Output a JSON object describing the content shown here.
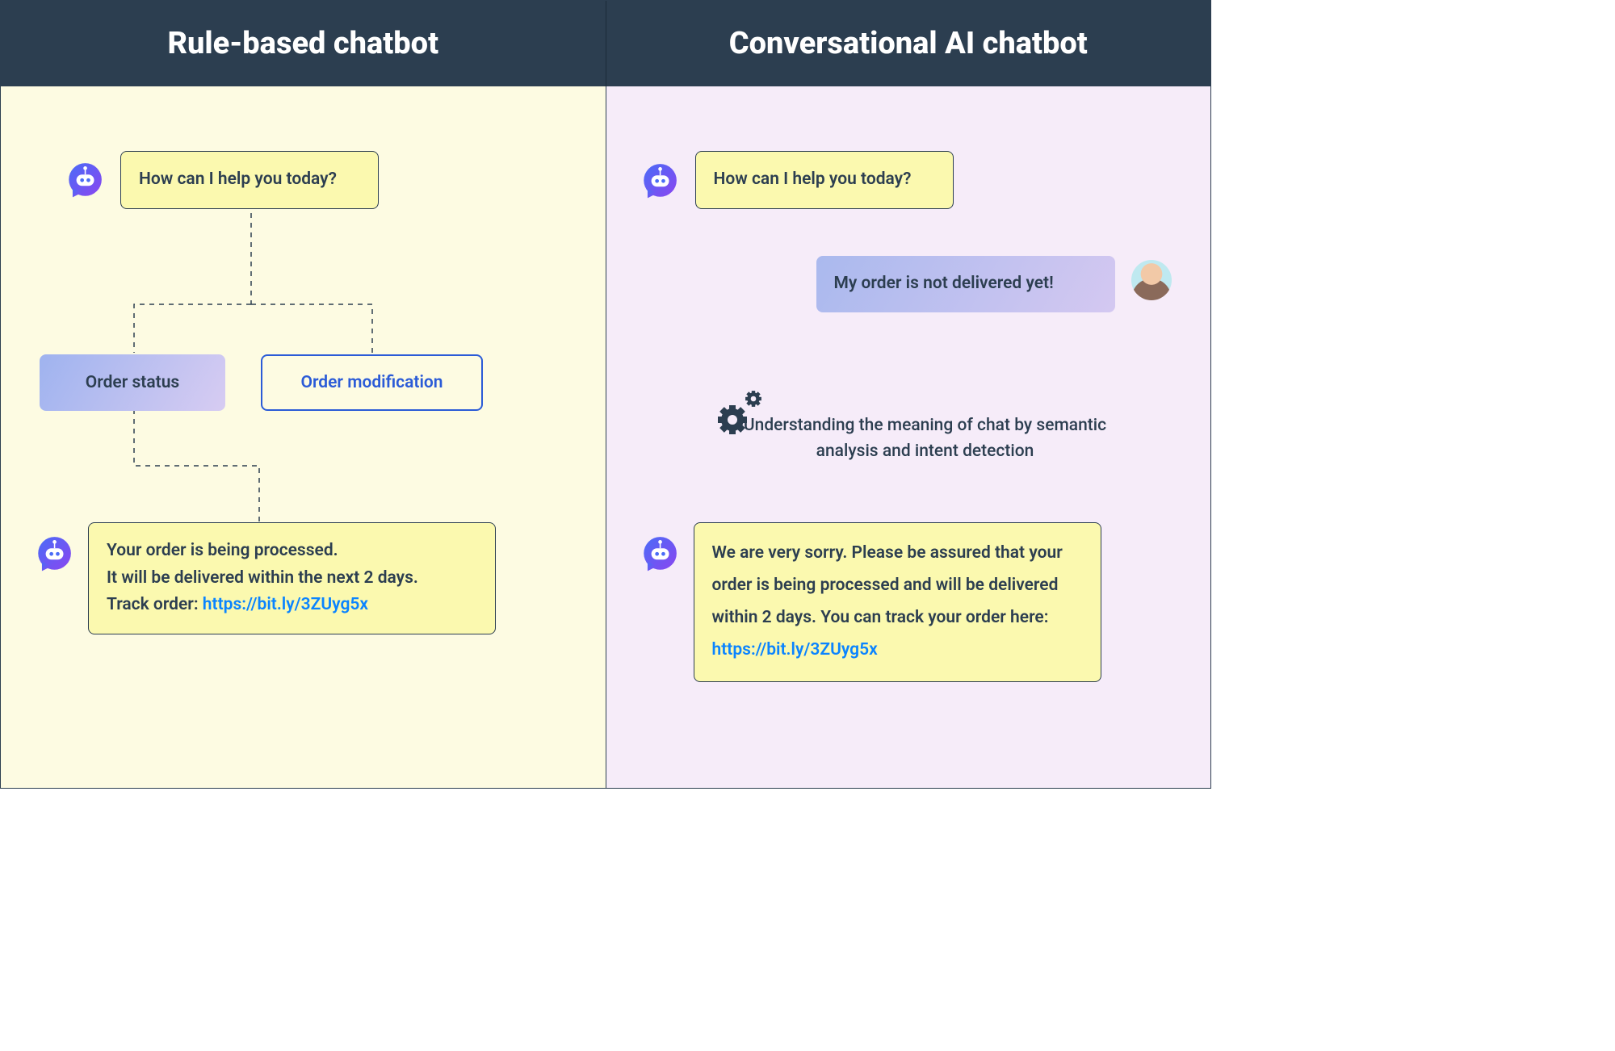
{
  "header": {
    "left_title": "Rule-based chatbot",
    "right_title": "Conversational AI chatbot"
  },
  "left": {
    "bot_greeting": "How can I help you today?",
    "options": {
      "selected": "Order status",
      "unselected": "Order modification"
    },
    "bot_response_line1": "Your order is being processed.",
    "bot_response_line2": "It will be delivered within the next 2 days.",
    "bot_response_track_label": "Track order: ",
    "track_url": "https://bit.ly/3ZUyg5x"
  },
  "right": {
    "bot_greeting": "How can I help you today?",
    "user_message": "My order is not delivered yet!",
    "processing_caption": "Understanding the meaning of chat by semantic analysis and intent detection",
    "bot_response_prefix": "We are very sorry. Please be assured that your order is being processed and will be delivered within 2 days. You can track your order here: ",
    "track_url": "https://bit.ly/3ZUyg5x"
  }
}
